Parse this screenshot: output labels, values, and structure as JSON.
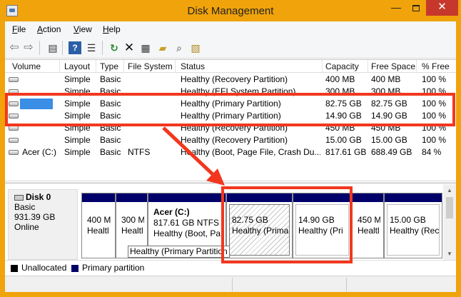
{
  "window": {
    "title": "Disk Management",
    "controls": {
      "minimize": "—",
      "close": "✕"
    }
  },
  "menu": [
    {
      "letter": "F",
      "rest": "ile"
    },
    {
      "letter": "A",
      "rest": "ction"
    },
    {
      "letter": "V",
      "rest": "iew"
    },
    {
      "letter": "H",
      "rest": "elp"
    }
  ],
  "toolbar": {
    "back": "⇦",
    "forward": "⇨",
    "console": "▤",
    "help": "?",
    "list": "☰",
    "refresh": "↻",
    "delete": "✕",
    "properties": "▦",
    "open": "▰",
    "search": "⌕",
    "settings": "▧"
  },
  "volume_list": {
    "columns": [
      "Volume",
      "Layout",
      "Type",
      "File System",
      "Status",
      "Capacity",
      "Free Space",
      "% Free"
    ],
    "rows": [
      {
        "volume": "",
        "layout": "Simple",
        "type": "Basic",
        "fs": "",
        "status": "Healthy (Recovery Partition)",
        "capacity": "400 MB",
        "free": "400 MB",
        "pct": "100 %"
      },
      {
        "volume": "",
        "layout": "Simple",
        "type": "Basic",
        "fs": "",
        "status": "Healthy (EFI System Partition)",
        "capacity": "300 MB",
        "free": "300 MB",
        "pct": "100 %"
      },
      {
        "volume": "",
        "layout": "Simple",
        "type": "Basic",
        "fs": "",
        "status": "Healthy (Primary Partition)",
        "capacity": "82.75 GB",
        "free": "82.75 GB",
        "pct": "100 %"
      },
      {
        "volume": "",
        "layout": "Simple",
        "type": "Basic",
        "fs": "",
        "status": "Healthy (Primary Partition)",
        "capacity": "14.90 GB",
        "free": "14.90 GB",
        "pct": "100 %"
      },
      {
        "volume": "",
        "layout": "Simple",
        "type": "Basic",
        "fs": "",
        "status": "Healthy (Recovery Partition)",
        "capacity": "450 MB",
        "free": "450 MB",
        "pct": "100 %"
      },
      {
        "volume": "",
        "layout": "Simple",
        "type": "Basic",
        "fs": "",
        "status": "Healthy (Recovery Partition)",
        "capacity": "15.00 GB",
        "free": "15.00 GB",
        "pct": "100 %"
      },
      {
        "volume": "Acer (C:)",
        "layout": "Simple",
        "type": "Basic",
        "fs": "NTFS",
        "status": "Healthy (Boot, Page File, Crash Du...",
        "capacity": "817.61 GB",
        "free": "688.49 GB",
        "pct": "84 %"
      }
    ]
  },
  "disk": {
    "name": "Disk 0",
    "type": "Basic",
    "size": "931.39 GB",
    "state": "Online"
  },
  "partitions": [
    {
      "label": "",
      "size": "400 M",
      "status": "Healtl"
    },
    {
      "label": "",
      "size": "300 M",
      "status": "Healtl"
    },
    {
      "label": "Acer  (C:)",
      "size": "817.61 GB NTFS",
      "status": "Healthy (Boot, Pa"
    },
    {
      "label": "",
      "size": "82.75 GB",
      "status": "Healthy (Prima"
    },
    {
      "label": "",
      "size": "14.90 GB",
      "status": "Healthy (Pri"
    },
    {
      "label": "",
      "size": "450 M",
      "status": "Healtl"
    },
    {
      "label": "",
      "size": "15.00 GB",
      "status": "Healthy (Rec"
    }
  ],
  "tooltip": "Healthy (Primary Partition",
  "legend": {
    "unallocated": "Unallocated",
    "primary": "Primary partition",
    "unallocated_color": "#000000",
    "primary_color": "#00006a"
  },
  "highlight_color": "#f2371e",
  "accent_color": "#f0a30a"
}
